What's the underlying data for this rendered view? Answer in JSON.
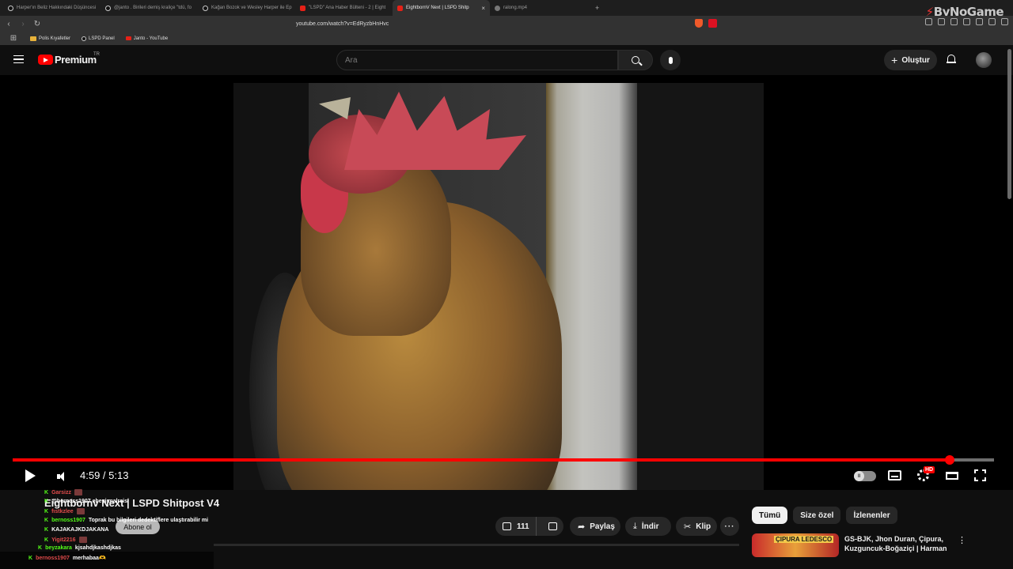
{
  "browser": {
    "tabs": [
      {
        "label": "Harper'ın Beliz Hakkındaki Düşüncesi",
        "icon": "tiktok-favicon"
      },
      {
        "label": "@janto . Birileri demiş kraliçe \"tdü, fo",
        "icon": "tiktok-favicon"
      },
      {
        "label": "Kağan Bozok ve Wesley Harper ile Ep",
        "icon": "tiktok-favicon"
      },
      {
        "label": "\"LSPD\" Ana Haber Bülteni - 2 | Eight",
        "icon": "youtube-favicon"
      },
      {
        "label": "EightbornV Next | LSPD Shitp",
        "icon": "youtube-favicon",
        "active": true
      },
      {
        "label": "ralong.mp4",
        "icon": "globe-favicon"
      }
    ],
    "new_tab": "+",
    "url": "youtube.com/watch?v=EdRyzbHnHvc",
    "bookmarks": [
      {
        "label": "Polis Kıyafetler",
        "icon": "folder-icon"
      },
      {
        "label": "LSPD Panel",
        "icon": "tiktok-icon"
      },
      {
        "label": "Janto - YouTube",
        "icon": "youtube-icon"
      }
    ],
    "watermark": "ByNoGame"
  },
  "youtube": {
    "logo_text": "Premium",
    "country_code": "TR",
    "search_placeholder": "Ara",
    "create_label": "Oluştur",
    "create_icon": "+"
  },
  "player": {
    "time": "4:59 / 5:13",
    "progress_fraction": 0.955,
    "hd_badge": "HD",
    "autoplay_label": "II"
  },
  "video": {
    "title": "Eightbornv Next | LSPD Shitpost V4",
    "subscribe_label": "Abone ol",
    "like_count": "111",
    "share_label": "Paylaş",
    "download_label": "İndir",
    "clip_label": "Klip",
    "more_label": "···"
  },
  "sidebar": {
    "chips": [
      "Tümü",
      "Size özel",
      "İzlenenler"
    ],
    "recommendation": {
      "thumb_text": "ÇIPURA LEDESCO",
      "title": "GS-BJK, Jhon Duran, Çipura, Kuzguncuk-Boğaziçi | Harman"
    }
  },
  "chat": {
    "messages": [
      {
        "user": "Garsizz",
        "text": "",
        "color": "#e04a4a"
      },
      {
        "user": "",
        "text": "@bernoss1907 ebeyi malreisi",
        "color": "#9b59d0"
      },
      {
        "user": "fıstkzlee",
        "text": "",
        "color": "#e04a4a"
      },
      {
        "user": "bernoss1907",
        "text": "Toprak bu bilgileri dedektiflere ulaştırabilir mi",
        "color": "#53fc18"
      },
      {
        "user": "",
        "text": "KAJAKAJKDJAKANA",
        "color": "#3aa0ff"
      },
      {
        "user": "Yigit2216",
        "text": "",
        "color": "#e04a4a"
      },
      {
        "user": "beyzakara",
        "text": "kjsahdjkashdjkas",
        "color": "#53fc18"
      },
      {
        "user": "bernoss1907",
        "text": "merhabaa🫶",
        "color": "#e04a4a"
      }
    ]
  }
}
